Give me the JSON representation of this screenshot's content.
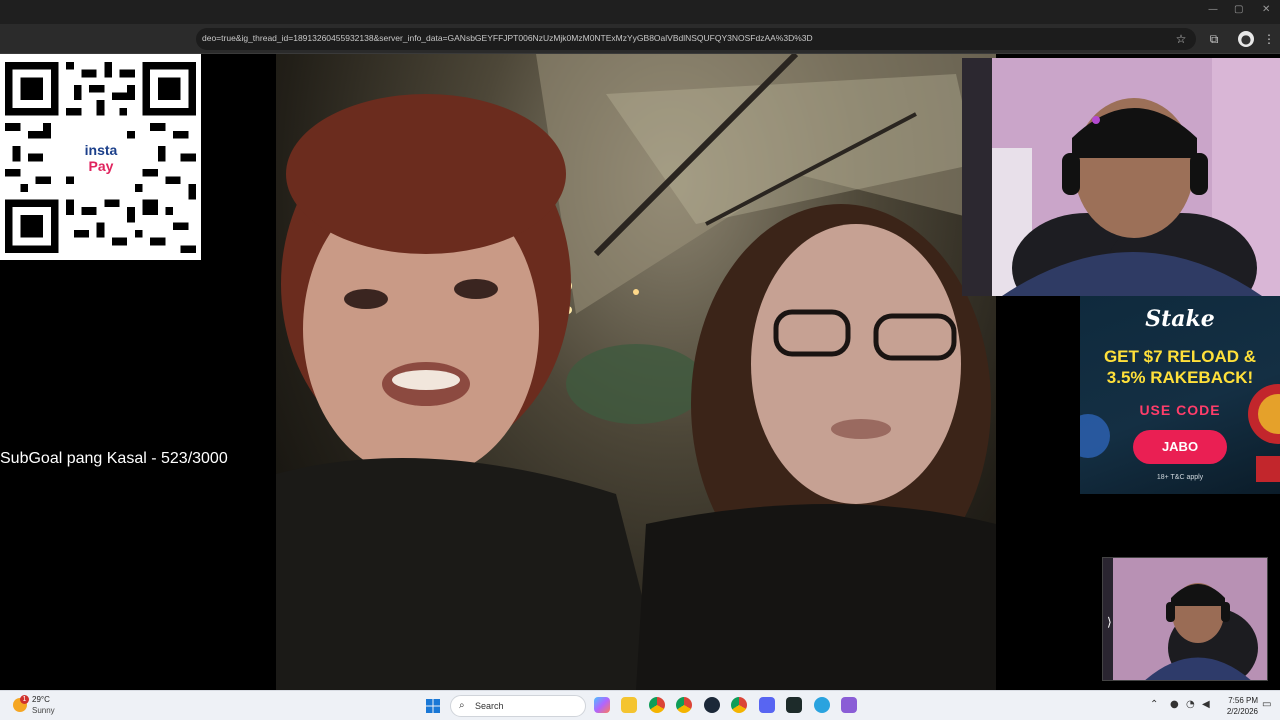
{
  "browser": {
    "url": "deo=true&ig_thread_id=18913260455932138&server_info_data=GANsbGEYFFJPT006NzUzMjk0MzM0NTExMzYyGB8OalVBdlNSQUFQY3NOSFdzAA%3D%3D",
    "bookmark_icon": "star-icon",
    "extensions_icon": "puzzle-icon",
    "profile_icon": "avatar-icon",
    "menu_icon": "kebab-menu-icon",
    "window_controls": [
      "—",
      "▢",
      "✕"
    ]
  },
  "stream": {
    "qr": {
      "logo_line1": "insta",
      "logo_line2": "Pay"
    },
    "subgoal_text": "SubGoal pang Kasal - 523/3000",
    "ad": {
      "brand": "Stake",
      "headline_line1": "GET $7 RELOAD &",
      "headline_line2": "3.5% RAKEBACK!",
      "use_code_label": "USE CODE",
      "code": "JABO",
      "fine_print": "18+ T&C apply",
      "colors": {
        "headline": "#ffe03a",
        "button": "#ea1f53"
      }
    }
  },
  "taskbar": {
    "weather": {
      "badge": "1",
      "temp": "29°C",
      "condition": "Sunny"
    },
    "search_label": "Search",
    "apps": [
      "copilot-icon",
      "file-explorer-icon",
      "chrome-icon",
      "chrome-icon",
      "steam-icon",
      "chrome-profile-icon",
      "discord-icon",
      "app-icon",
      "telegram-icon",
      "snipping-tool-icon"
    ],
    "clock": {
      "time": "7:56 PM",
      "date": "2/2/2026"
    }
  }
}
